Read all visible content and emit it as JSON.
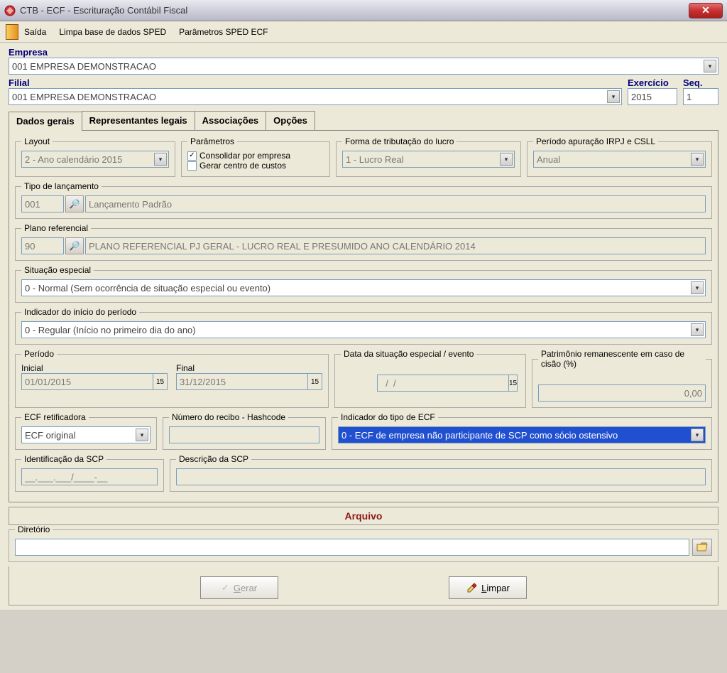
{
  "window": {
    "title": "CTB - ECF - Escrituração Contábil Fiscal"
  },
  "menu": {
    "exit": "Saída",
    "clear_sped": "Limpa base de dados SPED",
    "params_sped": "Parâmetros SPED ECF"
  },
  "header": {
    "empresa_label": "Empresa",
    "empresa_value": "001 EMPRESA DEMONSTRACAO",
    "filial_label": "Filial",
    "filial_value": "001 EMPRESA DEMONSTRACAO",
    "exercicio_label": "Exercício",
    "exercicio_value": "2015",
    "seq_label": "Seq.",
    "seq_value": "1"
  },
  "tabs": {
    "dados": "Dados gerais",
    "repr": "Representantes legais",
    "assoc": "Associações",
    "opcoes": "Opções"
  },
  "form": {
    "layout_label": "Layout",
    "layout_value": "2 - Ano calendário 2015",
    "params_label": "Parâmetros",
    "consolidar_label": "Consolidar por empresa",
    "gerar_centro_label": "Gerar centro de custos",
    "forma_trib_label": "Forma de tributação do lucro",
    "forma_trib_value": "1 - Lucro Real",
    "periodo_apur_label": "Período apuração IRPJ e CSLL",
    "periodo_apur_value": "Anual",
    "tipo_lanc_label": "Tipo de lançamento",
    "tipo_lanc_code": "001",
    "tipo_lanc_desc": "Lançamento Padrão",
    "plano_ref_label": "Plano referencial",
    "plano_ref_code": "90",
    "plano_ref_desc": "PLANO REFERENCIAL PJ GERAL - LUCRO REAL E PRESUMIDO ANO CALENDÁRIO 2014",
    "situacao_label": "Situação especial",
    "situacao_value": "0 - Normal (Sem ocorrência de situação especial ou evento)",
    "indicador_inicio_label": "Indicador do início do período",
    "indicador_inicio_value": "0 - Regular (Início no primeiro dia do ano)",
    "periodo_label": "Período",
    "periodo_inicial_label": "Inicial",
    "periodo_inicial_value": "01/01/2015",
    "periodo_final_label": "Final",
    "periodo_final_value": "31/12/2015",
    "data_situacao_label": "Data da situação especial / evento",
    "data_situacao_value": "  /  /",
    "patrimonio_label": "Patrimônio remanescente em caso de cisão (%)",
    "patrimonio_value": "0,00",
    "ecf_retif_label": "ECF retificadora",
    "ecf_retif_value": "ECF original",
    "numero_recibo_label": "Número do recibo - Hashcode",
    "numero_recibo_value": "",
    "indicador_tipo_label": "Indicador do tipo de ECF",
    "indicador_tipo_value": "0 - ECF de empresa não participante de SCP como sócio ostensivo",
    "id_scp_label": "Identificação da SCP",
    "id_scp_value": "__.___.___/____-__",
    "desc_scp_label": "Descrição da SCP",
    "desc_scp_value": ""
  },
  "arquivo": {
    "section_title": "Arquivo",
    "diretorio_label": "Diretório",
    "diretorio_value": ""
  },
  "buttons": {
    "gerar": "Gerar",
    "limpar": "Limpar"
  }
}
